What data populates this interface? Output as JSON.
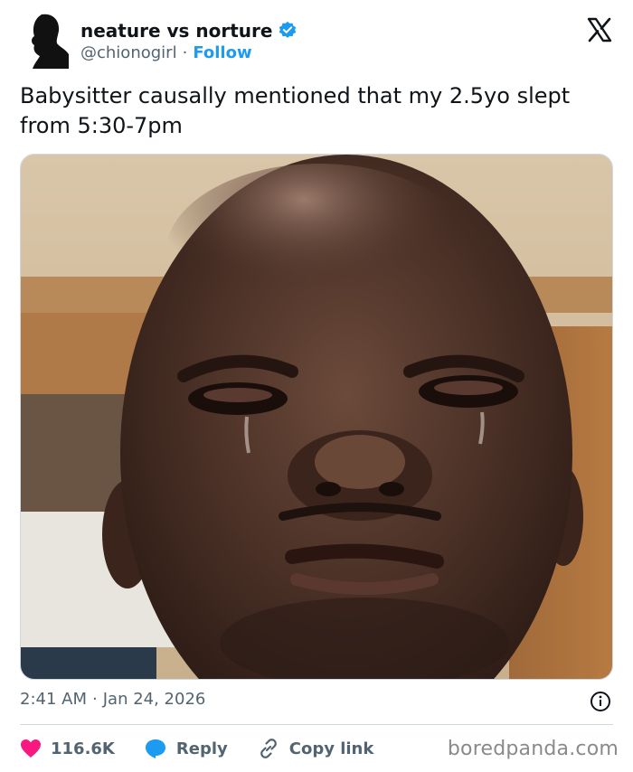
{
  "tweet": {
    "display_name": "neature vs norture",
    "handle": "@chionogirl",
    "follow_label": "Follow",
    "separator": "·",
    "text": "Babysitter causally mentioned that my 2.5yo slept from 5:30-7pm",
    "time": "2:41 AM",
    "date": "Jan 24, 2026"
  },
  "actions": {
    "like_count": "116.6K",
    "reply_label": "Reply",
    "copy_label": "Copy link"
  },
  "watermark": "boredpanda.com",
  "colors": {
    "accent": "#1d9bf0",
    "like": "#f91880",
    "text": "#0f1419",
    "muted": "#536471"
  },
  "icons": [
    "avatar-silhouette",
    "verified-badge-icon",
    "x-logo-icon",
    "info-icon",
    "heart-icon",
    "reply-bubble-icon",
    "link-icon"
  ]
}
